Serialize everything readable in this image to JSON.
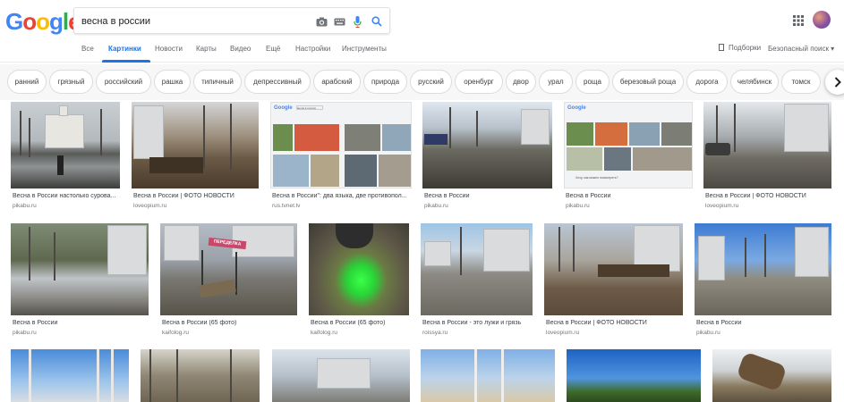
{
  "header": {
    "logo": [
      {
        "char": "G",
        "color": "#4285F4"
      },
      {
        "char": "o",
        "color": "#EA4335"
      },
      {
        "char": "o",
        "color": "#FBBC05"
      },
      {
        "char": "g",
        "color": "#4285F4"
      },
      {
        "char": "l",
        "color": "#34A853"
      },
      {
        "char": "e",
        "color": "#EA4335"
      }
    ],
    "search_query": "весна в россии",
    "icons": [
      "camera-icon",
      "keyboard-icon",
      "microphone-icon",
      "search-icon",
      "apps-icon"
    ]
  },
  "tabs": {
    "items": [
      {
        "label": "Все"
      },
      {
        "label": "Картинки",
        "active": true
      },
      {
        "label": "Новости"
      },
      {
        "label": "Карты"
      },
      {
        "label": "Видео"
      },
      {
        "label": "Ещё"
      },
      {
        "label": "Настройки"
      },
      {
        "label": "Инструменты"
      }
    ],
    "collections": "Подборки",
    "safesearch": "Безопасный поиск ▾"
  },
  "chips": [
    "ранний",
    "грязный",
    "российский",
    "рашка",
    "типичный",
    "депрессивный",
    "арабский",
    "природа",
    "русский",
    "оренбург",
    "двор",
    "урал",
    "роща",
    "березовый роща",
    "дорога",
    "челябинск",
    "томск"
  ],
  "results": [
    {
      "title": "Весна в России настолько сурова...",
      "source": "pikabu.ru"
    },
    {
      "title": "Весна в России | ФОТО НОВОСТИ",
      "source": "loveopium.ru"
    },
    {
      "title": "Весна в России\": два языка, две противопол...",
      "source": "rus.tvnet.lv"
    },
    {
      "title": "Весна в России",
      "source": "pikabu.ru"
    },
    {
      "title": "Весна в России",
      "source": "pikabu.ru"
    },
    {
      "title": "Весна в России | ФОТО НОВОСТИ",
      "source": "loveopium.ru"
    },
    {
      "title": "Весна в России",
      "source": "pikabu.ru"
    },
    {
      "title": "Весна в России (65 фото)",
      "source": "kaifolog.ru"
    },
    {
      "title": "Весна в России (65 фото)",
      "source": "kaifolog.ru"
    },
    {
      "title": "Весна в России - это лужи и грязь",
      "source": "roissya.ru"
    },
    {
      "title": "Весна в России | ФОТО НОВОСТИ",
      "source": "loveopium.ru"
    },
    {
      "title": "Весна в России",
      "source": "pikabu.ru"
    }
  ],
  "thumb_text": {
    "sign": "ПЕРЕДЕЛКА",
    "mini_query": "весна в россии",
    "mini_caption": "Хочу, как можно посмотреть?"
  }
}
